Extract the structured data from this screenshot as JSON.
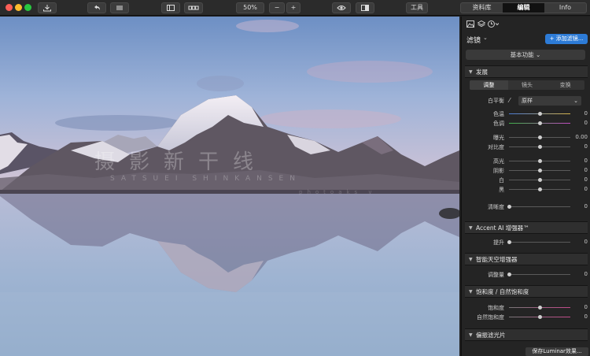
{
  "toolbar": {
    "zoom": "50%",
    "zoom_minus": "−",
    "zoom_plus": "+",
    "tools_label": "工具",
    "tabs": [
      "资料库",
      "编辑",
      "Info"
    ]
  },
  "panel": {
    "filters_title": "滤镜",
    "add_filter": "+ 添加滤镜...",
    "basic_functions": "基本功能",
    "sections": {
      "develop": "发展",
      "accent_ai": "Accent AI 增强器™",
      "sky": "智能天空增强器",
      "saturation": "饱和度 / 自然饱和度",
      "polarizer": "偏振滤光片"
    },
    "subtabs": [
      "调整",
      "镜头",
      "变换"
    ],
    "white_balance": {
      "label": "白平衡",
      "value": "原样"
    },
    "develop_sliders": [
      {
        "label": "色温",
        "value": "0",
        "pos": 0.5
      },
      {
        "label": "色调",
        "value": "0",
        "pos": 0.5
      },
      {
        "label": "曝光",
        "value": "0.00",
        "pos": 0.5
      },
      {
        "label": "对比度",
        "value": "0",
        "pos": 0.5
      },
      {
        "label": "高光",
        "value": "0",
        "pos": 0.5
      },
      {
        "label": "阴影",
        "value": "0",
        "pos": 0.5
      },
      {
        "label": "白",
        "value": "0",
        "pos": 0.5
      },
      {
        "label": "黑",
        "value": "0",
        "pos": 0.5
      },
      {
        "label": "清晰度",
        "value": "0",
        "pos": 0.0
      }
    ],
    "accent_sliders": [
      {
        "label": "提升",
        "value": "0",
        "pos": 0.0
      }
    ],
    "sky_sliders": [
      {
        "label": "调整量",
        "value": "0",
        "pos": 0.0
      }
    ],
    "saturation_sliders": [
      {
        "label": "饱和度",
        "value": "0",
        "pos": 0.5
      },
      {
        "label": "自然饱和度",
        "value": "0",
        "pos": 0.5
      }
    ],
    "save_button": "保存Luminar效果..."
  },
  "watermark": {
    "main": "摄影新干线",
    "sub": "SATSUEI SHINKANSEN",
    "sub2": "photoaks v"
  },
  "colors": {
    "accent": "#2d7bd6",
    "active_tab": "#111111"
  }
}
